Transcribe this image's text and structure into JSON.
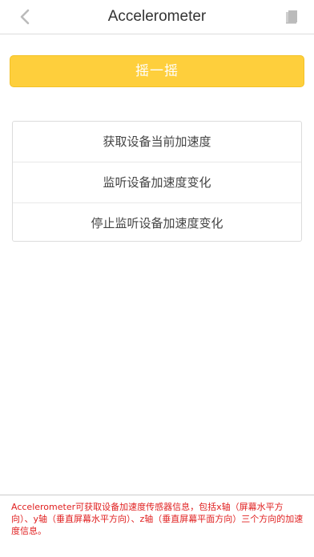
{
  "navbar": {
    "title": "Accelerometer",
    "back_icon": "chevron-left-icon",
    "right_icon": "book-icon",
    "icon_color": "#bbbbbb"
  },
  "shake_button": {
    "label": "摇一摇",
    "bg_color": "#fecf3c"
  },
  "menu": {
    "items": [
      {
        "label": "获取设备当前加速度"
      },
      {
        "label": "监听设备加速度变化"
      },
      {
        "label": "停止监听设备加速度变化"
      }
    ]
  },
  "footer": {
    "description": "Accelerometer可获取设备加速度传感器信息，包括x轴（屏幕水平方向）、y轴（垂直屏幕水平方向）、z轴（垂直屏幕平面方向）三个方向的加速度信息。",
    "text_color": "#e02020"
  }
}
